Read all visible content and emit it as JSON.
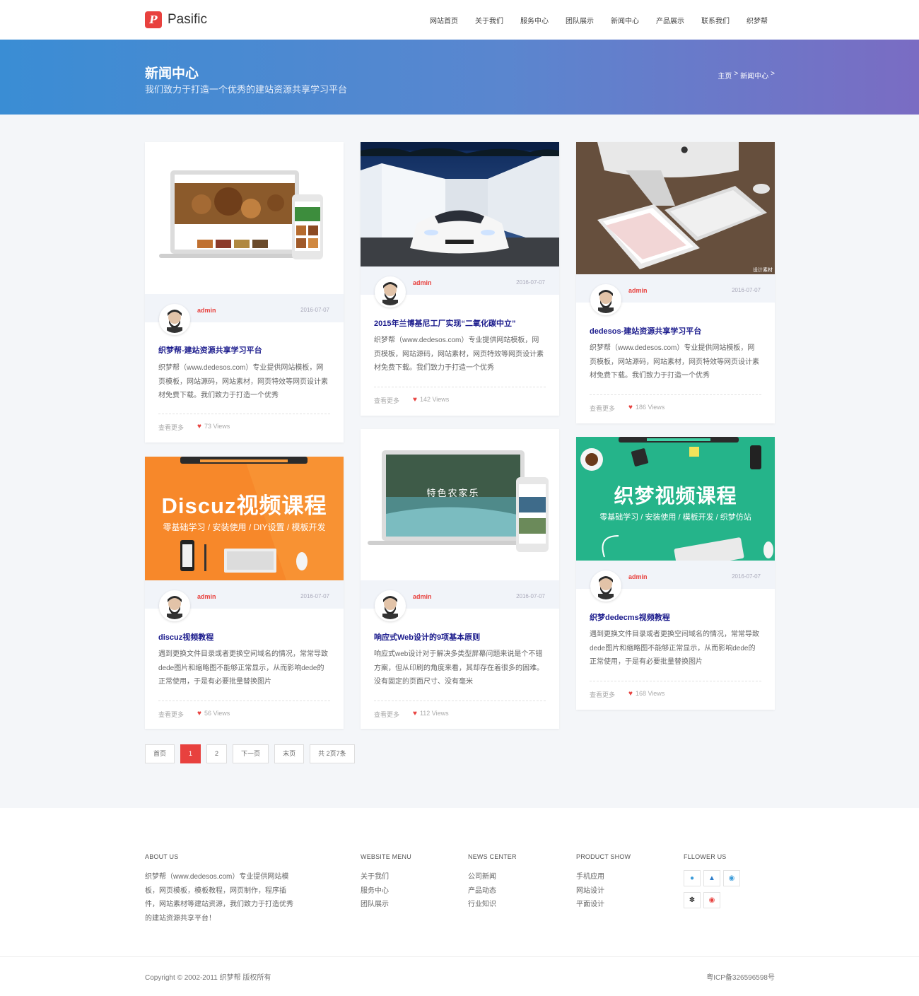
{
  "header": {
    "logo_text": "Pasific",
    "nav": [
      "网站首页",
      "关于我们",
      "服务中心",
      "团队展示",
      "新闻中心",
      "产品展示",
      "联系我们",
      "织梦帮"
    ]
  },
  "banner": {
    "title": "新闻中心",
    "subtitle": "我们致力于打造一个优秀的建站资源共享学习平台",
    "breadcrumb": [
      "主页",
      ">",
      "新闻中心",
      ">"
    ]
  },
  "cards": [
    {
      "author": "admin",
      "date": "2016-07-07",
      "title": "织梦帮-建站资源共享学习平台",
      "excerpt": "织梦帮（www.dedesos.com）专业提供网站模板，网页模板，网站源码，网站素材，网页特效等网页设计素材免费下载。我们致力于打造一个优秀",
      "more": "查看更多",
      "views": "73 Views"
    },
    {
      "author": "admin",
      "date": "2016-07-07",
      "title": "2015年兰博基尼工厂实现“二氧化碳中立”",
      "excerpt": "织梦帮（www.dedesos.com）专业提供网站模板，网页模板，网站源码，网站素材，网页特效等网页设计素材免费下载。我们致力于打造一个优秀",
      "more": "查看更多",
      "views": "142 Views"
    },
    {
      "author": "admin",
      "date": "2016-07-07",
      "title": "dedesos-建站资源共享学习平台",
      "excerpt": "织梦帮（www.dedesos.com）专业提供网站模板，网页模板，网站源码，网站素材，网页特效等网页设计素材免费下载。我们致力于打造一个优秀",
      "more": "查看更多",
      "views": "186 Views"
    },
    {
      "author": "admin",
      "date": "2016-07-07",
      "title": "discuz视频教程",
      "excerpt": "遇到更换文件目录或者更换空间域名的情况，常常导致dede图片和缩略图不能够正常显示，从而影响dede的正常使用，于是有必要批量替换图片",
      "more": "查看更多",
      "views": "56 Views",
      "thumb_title": "Discuz视频课程",
      "thumb_sub": "零基础学习 / 安装使用 / DIY设置 / 模板开发"
    },
    {
      "author": "admin",
      "date": "2016-07-07",
      "title": "响应式Web设计的9项基本原则",
      "excerpt": "响应式web设计对于解决多类型屏幕问题来说是个不错方案，但从印刷的角度来看，其却存在着很多的困难。没有固定的页面尺寸、没有毫米",
      "more": "查看更多",
      "views": "112 Views",
      "thumb_title": "特色农家乐"
    },
    {
      "author": "admin",
      "date": "2016-07-07",
      "title": "织梦dedecms视频教程",
      "excerpt": "遇到更换文件目录或者更换空间域名的情况，常常导致dede图片和缩略图不能够正常显示，从而影响dede的正常使用，于是有必要批量替换图片",
      "more": "查看更多",
      "views": "168 Views",
      "thumb_title": "织梦视频课程",
      "thumb_sub": "零基础学习 / 安装使用 / 模板开发 / 织梦仿站"
    }
  ],
  "pager": [
    "首页",
    "1",
    "2",
    "下一页",
    "末页",
    "共 2页7条"
  ],
  "footer": {
    "about_head": "ABOUT US",
    "about_text": "织梦帮（www.dedesos.com）专业提供网站模板，网页模板，模板教程，网页制作，程序插件，网站素材等建站资源，我们致力于打造优秀的建站资源共享平台！",
    "menu_head": "WEBSITE MENU",
    "menu": [
      "关于我们",
      "服务中心",
      "团队展示"
    ],
    "news_head": "NEWS CENTER",
    "news": [
      "公司新闻",
      "产品动态",
      "行业知识"
    ],
    "product_head": "PRODUCT SHOW",
    "product": [
      "手机应用",
      "网站设计",
      "平面设计"
    ],
    "follow_head": "FLLOWER US",
    "copyright": "Copyright © 2002-2011 织梦帮 版权所有",
    "icp": "粤ICP备326596598号"
  },
  "colors": {
    "accent": "#e8413e",
    "title_blue": "#1a1a8c",
    "banner_start": "#3a8dd4",
    "banner_end": "#7a6cc3"
  }
}
